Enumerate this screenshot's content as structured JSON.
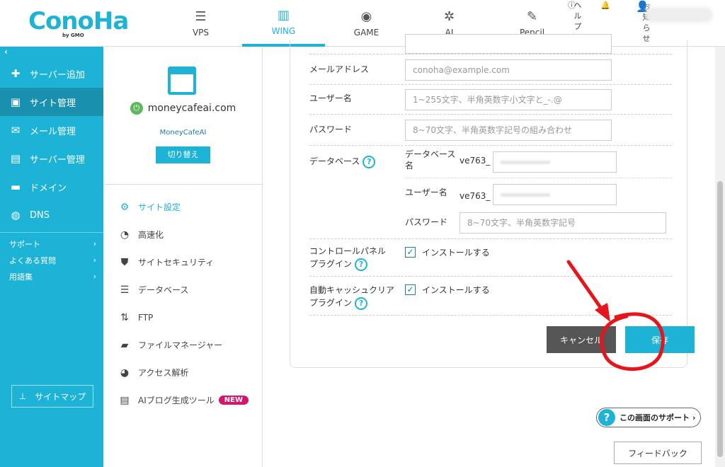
{
  "brand": {
    "logo_text": "ConoHa",
    "logo_sub": "by GMO"
  },
  "topnav": [
    {
      "label": "VPS",
      "icon": "server-icon"
    },
    {
      "label": "WING",
      "icon": "building-icon",
      "active": true
    },
    {
      "label": "GAME",
      "icon": "gamepad-icon"
    },
    {
      "label": "AI",
      "icon": "ai-icon"
    },
    {
      "label": "Pencil",
      "icon": "pencil-doc-icon"
    }
  ],
  "toputil": {
    "help": "ヘルプ",
    "notice": "お知らせ"
  },
  "sidebar": {
    "items": [
      {
        "label": "サーバー追加",
        "icon": "plus-icon"
      },
      {
        "label": "サイト管理",
        "icon": "window-icon",
        "active": true
      },
      {
        "label": "メール管理",
        "icon": "mail-icon"
      },
      {
        "label": "サーバー管理",
        "icon": "server-manage-icon"
      },
      {
        "label": "ドメイン",
        "icon": "domain-icon"
      },
      {
        "label": "DNS",
        "icon": "globe-icon"
      }
    ],
    "links": [
      {
        "label": "サポート"
      },
      {
        "label": "よくある質問"
      },
      {
        "label": "用語集"
      }
    ],
    "sitemap_label": "サイトマップ"
  },
  "site": {
    "domain": "moneycafeai.com",
    "name": "MoneyCafeAI",
    "switch_label": "切り替え"
  },
  "site_menu": [
    {
      "label": "サイト設定",
      "icon": "site-settings-icon",
      "active": true
    },
    {
      "label": "高速化",
      "icon": "stopwatch-icon"
    },
    {
      "label": "サイトセキュリティ",
      "icon": "shield-icon"
    },
    {
      "label": "データベース",
      "icon": "database-icon"
    },
    {
      "label": "FTP",
      "icon": "updown-arrows-icon"
    },
    {
      "label": "ファイルマネージャー",
      "icon": "folder-icon"
    },
    {
      "label": "アクセス解析",
      "icon": "pie-chart-icon"
    },
    {
      "label": "AIブログ生成ツール",
      "icon": "ai-doc-icon",
      "badge": "NEW"
    }
  ],
  "form": {
    "email": {
      "label": "メールアドレス",
      "placeholder": "conoha@example.com"
    },
    "username": {
      "label": "ユーザー名",
      "placeholder": "1~255文字、半角英数字小文字と_-.@"
    },
    "password": {
      "label": "パスワード",
      "placeholder": "8~70文字、半角英数字記号の組み合わせ"
    },
    "database": {
      "label": "データベース",
      "db_name_label": "データベース名",
      "db_prefix": "ve763_",
      "user_label": "ユーザー名",
      "user_prefix": "ve763_",
      "password_label": "パスワード",
      "password_placeholder": "8~70文字、半角英数字記号"
    },
    "cp_plugin": {
      "label_line1": "コントロールパネル",
      "label_line2": "プラグイン",
      "check_label": "インストールする",
      "checked": true
    },
    "cache_plugin": {
      "label_line1": "自動キャッシュクリア",
      "label_line2": "プラグイン",
      "check_label": "インストールする",
      "checked": true
    },
    "cancel_label": "キャンセル",
    "save_label": "保存"
  },
  "support_label": "この画面のサポート",
  "feedback_label": "フィードバック",
  "colors": {
    "accent": "#1db3d6",
    "annotation": "#e8141b",
    "badge": "#d4166f"
  }
}
